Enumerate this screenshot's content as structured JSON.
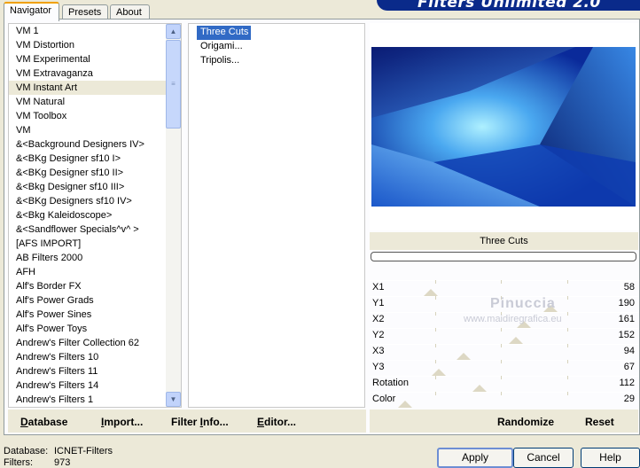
{
  "header": {
    "brand": "Filters Unlimited 2.0"
  },
  "tabs": [
    {
      "label": "Navigator",
      "active": true
    },
    {
      "label": "Presets",
      "active": false
    },
    {
      "label": "About",
      "active": false
    }
  ],
  "categories": {
    "selected": "VM Instant Art",
    "items": [
      "VM 1",
      "VM Distortion",
      "VM Experimental",
      "VM Extravaganza",
      "VM Instant Art",
      "VM Natural",
      "VM Toolbox",
      "VM",
      "&<Background Designers IV>",
      "&<BKg Designer sf10 I>",
      "&<BKg Designer sf10 II>",
      "&<Bkg Designer sf10 III>",
      "&<BKg Designers sf10 IV>",
      "&<Bkg Kaleidoscope>",
      "&<Sandflower Specials^v^ >",
      "[AFS IMPORT]",
      "AB Filters 2000",
      "AFH",
      "Alf's Border FX",
      "Alf's Power Grads",
      "Alf's Power Sines",
      "Alf's Power Toys",
      "Andrew's Filter Collection 62",
      "Andrew's Filters 10",
      "Andrew's Filters 11",
      "Andrew's Filters 14",
      "Andrew's Filters 1"
    ]
  },
  "filters": {
    "selected": "Three Cuts",
    "items": [
      "Three Cuts",
      "Origami...",
      "Tripolis..."
    ]
  },
  "preview": {
    "filter_name": "Three Cuts",
    "progress": 0
  },
  "watermark": {
    "line1": "Pinuccia",
    "line2": "www.maidiregrafica.eu"
  },
  "parameters": [
    {
      "label": "X1",
      "value": "58"
    },
    {
      "label": "Y1",
      "value": "190"
    },
    {
      "label": "X2",
      "value": "161"
    },
    {
      "label": "Y2",
      "value": "152"
    },
    {
      "label": "X3",
      "value": "94"
    },
    {
      "label": "Y3",
      "value": "67"
    },
    {
      "label": "Rotation",
      "value": "112"
    },
    {
      "label": "Color",
      "value": "29"
    }
  ],
  "left_toolbar": {
    "database_prefix": "D",
    "database_rest": "atabase",
    "import_prefix": "I",
    "import_rest": "mport...",
    "filterinfo_a": "Filter ",
    "filterinfo_u": "I",
    "filterinfo_b": "nfo...",
    "editor_prefix": "E",
    "editor_rest": "ditor..."
  },
  "right_toolbar": {
    "randomize": "Randomize",
    "reset": "Reset"
  },
  "status": {
    "database_label": "Database:",
    "database_value": "ICNET-Filters",
    "filters_label": "Filters:",
    "filters_value": "973"
  },
  "buttons": {
    "apply": "Apply",
    "cancel": "Cancel",
    "help": "Help"
  },
  "colors": {
    "selection": "#316ac5",
    "window_bg": "#ece9d8",
    "banner": "#0a2a8a"
  }
}
